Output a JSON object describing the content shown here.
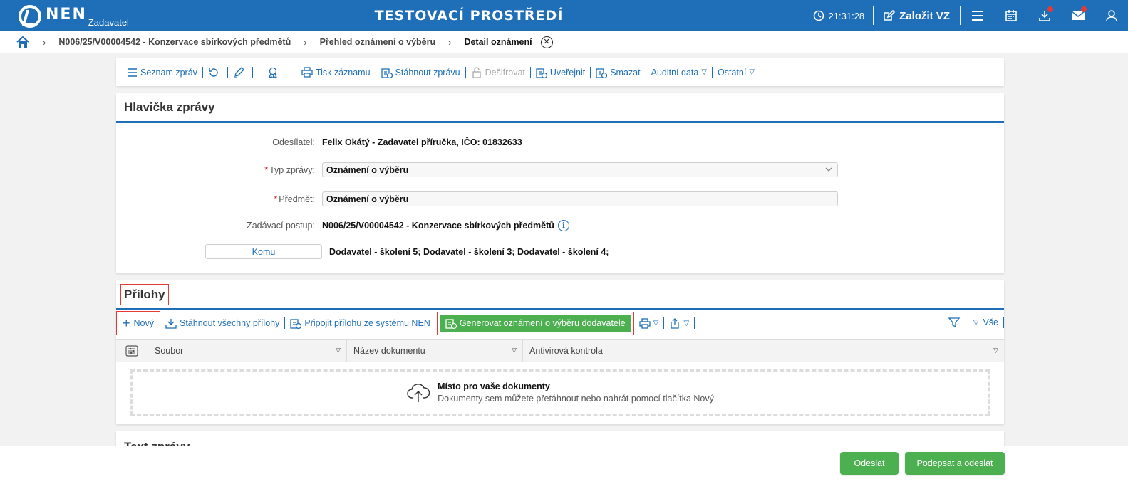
{
  "header": {
    "logo": "NEN",
    "logo_sub": "Zadavatel",
    "env_title": "TESTOVACÍ PROSTŘEDÍ",
    "time": "21:31:28",
    "create_label": "Založit VZ",
    "icons": [
      "menu-icon",
      "calendar-icon",
      "download-icon",
      "mail-icon",
      "user-icon"
    ]
  },
  "breadcrumb": {
    "items": [
      "N006/25/V00004542 - Konzervace sbírkových předmětů",
      "Přehled oznámení o výběru",
      "Detail oznámení"
    ]
  },
  "toolbar": {
    "list": "Seznam zpráv",
    "print": "Tisk záznamu",
    "download": "Stáhnout zprávu",
    "decrypt": "Dešifrovat",
    "publish": "Uveřejnit",
    "delete": "Smazat",
    "audit": "Auditní data",
    "other": "Ostatní"
  },
  "message_header": {
    "title": "Hlavička zprávy",
    "sender_label": "Odesílatel:",
    "sender_value": "Felix Okátý - Zadavatel příručka, IČO: 01832633",
    "type_label": "Typ zprávy:",
    "type_value": "Oznámení o výběru",
    "subject_label": "Předmět:",
    "subject_value": "Oznámení o výběru",
    "procedure_label": "Zadávací postup:",
    "procedure_value": "N006/25/V00004542 - Konzervace sbírkových předmětů",
    "to_button": "Komu",
    "to_value": "Dodavatel - školení 5; Dodavatel - školení 3; Dodavatel - školení 4;",
    "required_mark": "*",
    "info_glyph": "i"
  },
  "attachments": {
    "title": "Přílohy",
    "new": "Nový",
    "download_all": "Stáhnout všechny přílohy",
    "attach_system": "Připojit přílohu ze systému NEN",
    "generate": "Generovat oznámení o výběru dodavatele",
    "all": "Vše",
    "columns": [
      "Soubor",
      "Název dokumentu",
      "Antivirová kontrola"
    ],
    "drop_title": "Místo pro vaše dokumenty",
    "drop_text": "Dokumenty sem můžete přetáhnout nebo nahrát pomocí tlačítka Nový"
  },
  "next_section": {
    "title": "Text zprávy"
  },
  "actions": {
    "send": "Odeslat",
    "sign_send": "Podepsat a odeslat"
  },
  "colors": {
    "brand": "#1f6fb8",
    "green": "#4caf50",
    "highlight": "#e53935"
  }
}
